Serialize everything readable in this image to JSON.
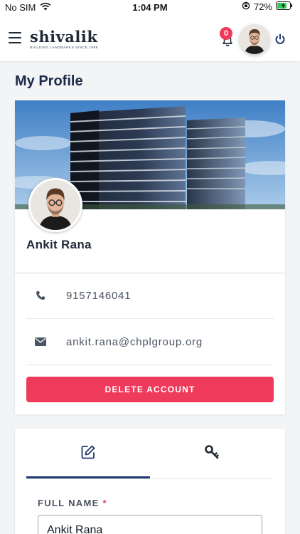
{
  "status": {
    "carrier": "No SIM",
    "time": "1:04 PM",
    "battery": "72%"
  },
  "header": {
    "logo_text": "shivalik",
    "logo_tagline": "BUILDING LANDMARKS SINCE 1998",
    "notification_count": "0"
  },
  "page": {
    "title": "My Profile"
  },
  "profile": {
    "name": "Ankit Rana",
    "phone": "9157146041",
    "email": "ankit.rana@chplgroup.org",
    "delete_label": "DELETE ACCOUNT"
  },
  "form": {
    "tabs": [
      {
        "icon": "edit-icon",
        "active": true
      },
      {
        "icon": "key-icon",
        "active": false
      }
    ],
    "full_name_label": "FULL NAME",
    "required_mark": "*",
    "full_name_value": "Ankit Rana"
  },
  "colors": {
    "accent": "#ef3b5b",
    "navy": "#1e3a6e",
    "title": "#1e2a4a"
  }
}
